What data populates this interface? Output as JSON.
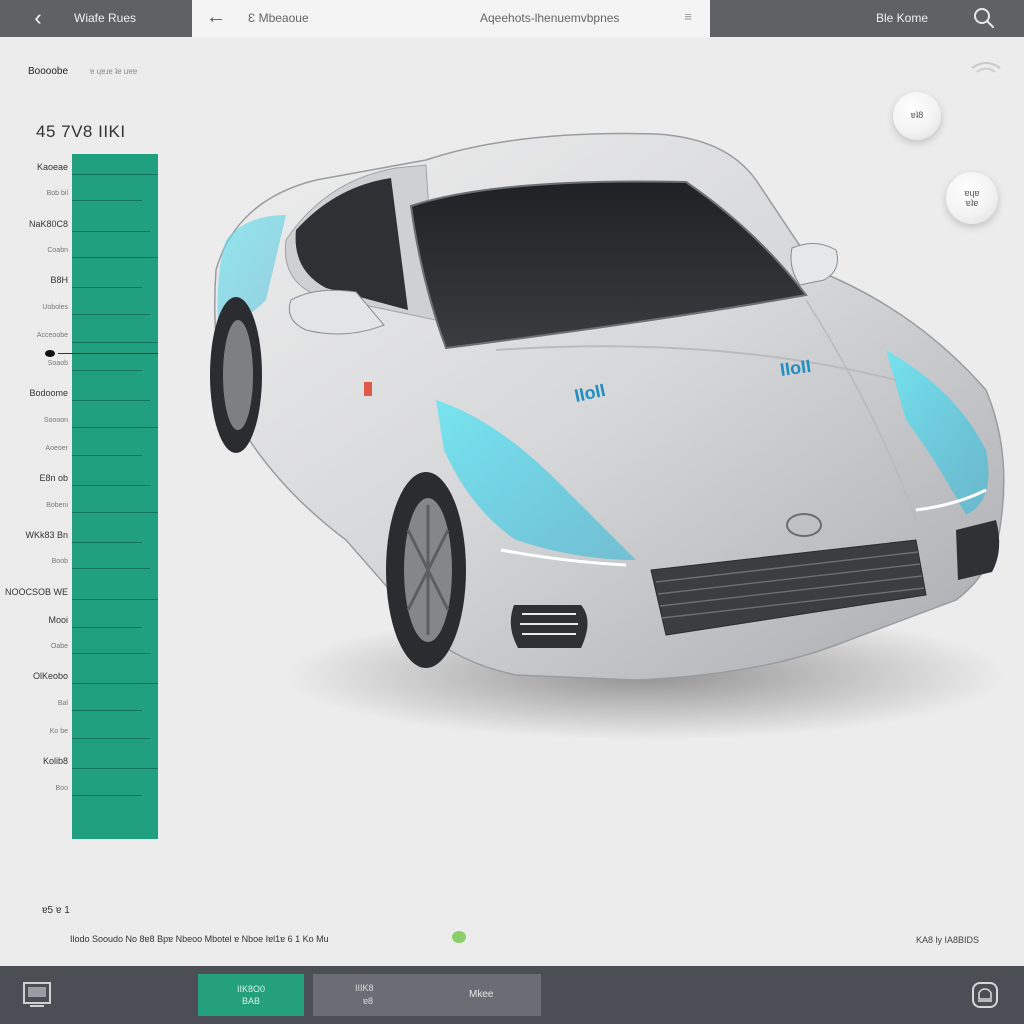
{
  "topbar": {
    "back_icon": "back-arrow-icon",
    "title": "Wiafe Rues",
    "search": {
      "back_icon": "arrow-left-icon",
      "query": "Ɛ Mbeaoue",
      "link_text": "Aqeehots-lhenuemvbpnes",
      "menu_icon": "equalizer-icon"
    },
    "right_label": "Ble Kome",
    "search_icon": "search-icon"
  },
  "subheader": {
    "label": "Boooobe",
    "sublabel": "ɐ ɥɐɹɐ ʇɐ uɐɐ",
    "wifi_icon": "wifi-icon"
  },
  "panel": {
    "value": "45 7V8 IIKI",
    "accent": "#21a07f",
    "labels": [
      {
        "text": "Kaoeae",
        "small": false
      },
      {
        "text": "Bob bil",
        "small": true
      },
      {
        "text": "NaK80C8",
        "small": false
      },
      {
        "text": "Coabn",
        "small": true
      },
      {
        "text": "B8H",
        "small": false
      },
      {
        "text": "Uoboles",
        "small": true
      },
      {
        "text": "Acceoobe",
        "small": true
      },
      {
        "text": "Soaob",
        "small": true
      },
      {
        "text": "Bodoome",
        "small": false
      },
      {
        "text": "Soooon",
        "small": true
      },
      {
        "text": "Aoeoer",
        "small": true
      },
      {
        "text": "E8n ob",
        "small": false
      },
      {
        "text": "Bobeni",
        "small": true
      },
      {
        "text": "WKk83 Bn",
        "small": false
      },
      {
        "text": "Boob",
        "small": true
      },
      {
        "text": "NOOCSOB WE",
        "small": false
      },
      {
        "text": "Mooi",
        "small": false
      },
      {
        "text": "Oabe",
        "small": true
      },
      {
        "text": "OlKeobo",
        "small": false
      },
      {
        "text": "Bal",
        "small": true
      },
      {
        "text": "Ko be",
        "small": true
      },
      {
        "text": "Kolib8",
        "small": false
      },
      {
        "text": "Boo",
        "small": true
      }
    ]
  },
  "car": {
    "hood_text": "IIoII",
    "body_color": "#d4d5d7",
    "glow_color": "#44d3e6"
  },
  "badges": [
    {
      "line1": "ɐʇ8",
      "line2": "ɐʇɐ"
    },
    {
      "line1": "ɐɥɐ",
      "line2": "ɐʇɐ"
    }
  ],
  "footer": {
    "small_label": "ɐ5 ɐ 1",
    "caption": "Ilodo Sooudo No 8ɐ8 Bpɐ Nbeoo Mbotel ɐ Nboe Iɐl1ɐ 6 1 Ko Mu",
    "right_text": "KA8 ly IA8BIDS"
  },
  "bottombar": {
    "left_icon": "monitor-icon",
    "green_button": {
      "line1": "IIK8O0",
      "line2": "BAB"
    },
    "grey_button": {
      "line1": "IIIK8",
      "line1b": "ɐ8",
      "line2": "Mkee"
    },
    "right_icon": "car-mode-icon",
    "button_color": "#25a07c"
  }
}
